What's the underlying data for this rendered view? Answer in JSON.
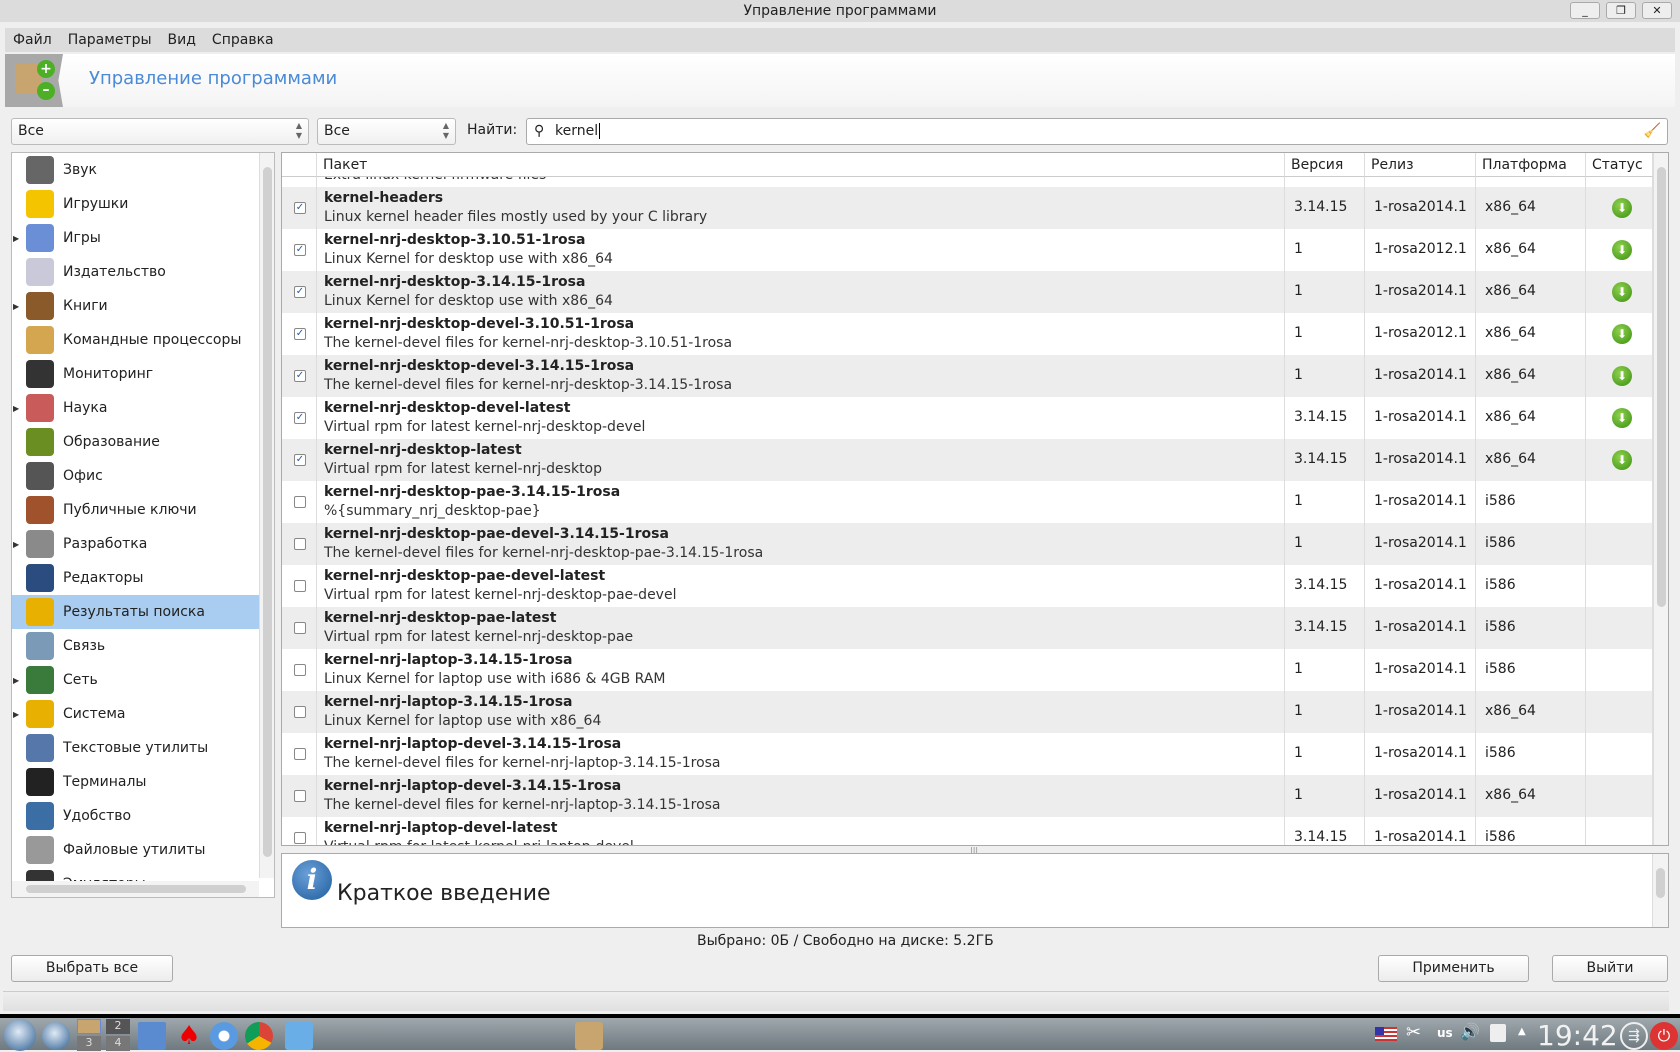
{
  "window": {
    "title": "Управление программами"
  },
  "menu": [
    "Файл",
    "Параметры",
    "Вид",
    "Справка"
  ],
  "banner": {
    "title": "Управление программами"
  },
  "filters": {
    "group": "Все",
    "state": "Все",
    "search_label": "Найти:",
    "search_value": "kernel"
  },
  "sidebar": [
    {
      "label": "Звук",
      "expand": false,
      "color": "#666"
    },
    {
      "label": "Игрушки",
      "expand": false,
      "color": "#f5c400"
    },
    {
      "label": "Игры",
      "expand": true,
      "color": "#6b8fd6"
    },
    {
      "label": "Издательство",
      "expand": false,
      "color": "#c9c9d9"
    },
    {
      "label": "Книги",
      "expand": true,
      "color": "#8b5a2b"
    },
    {
      "label": "Командные процессоры",
      "expand": false,
      "color": "#d4a650"
    },
    {
      "label": "Мониторинг",
      "expand": false,
      "color": "#333"
    },
    {
      "label": "Наука",
      "expand": true,
      "color": "#c95b5b"
    },
    {
      "label": "Образование",
      "expand": false,
      "color": "#6b8e23"
    },
    {
      "label": "Офис",
      "expand": false,
      "color": "#555"
    },
    {
      "label": "Публичные ключи",
      "expand": false,
      "color": "#a0522d"
    },
    {
      "label": "Разработка",
      "expand": true,
      "color": "#8a8a8a"
    },
    {
      "label": "Редакторы",
      "expand": false,
      "color": "#2b4c7e"
    },
    {
      "label": "Результаты поиска",
      "expand": false,
      "color": "#e8b000",
      "selected": true
    },
    {
      "label": "Связь",
      "expand": false,
      "color": "#7a9ab8"
    },
    {
      "label": "Сеть",
      "expand": true,
      "color": "#3a7a3a"
    },
    {
      "label": "Система",
      "expand": true,
      "color": "#e8b000"
    },
    {
      "label": "Текстовые утилиты",
      "expand": false,
      "color": "#5577aa"
    },
    {
      "label": "Терминалы",
      "expand": false,
      "color": "#222"
    },
    {
      "label": "Удобство",
      "expand": false,
      "color": "#3a6ea5"
    },
    {
      "label": "Файловые утилиты",
      "expand": false,
      "color": "#999"
    },
    {
      "label": "Эмуляторы",
      "expand": false,
      "color": "#333"
    }
  ],
  "table": {
    "columns": [
      "Пакет",
      "Версия",
      "Релиз",
      "Платформа",
      "Статус"
    ],
    "partial_top": "Extra linux kernel firmware files",
    "rows": [
      {
        "name": "kernel-headers",
        "desc": "Linux kernel header files mostly used by your C library",
        "version": "3.14.15",
        "release": "1-rosa2014.1",
        "platform": "x86_64",
        "checked": true,
        "installed": true
      },
      {
        "name": "kernel-nrj-desktop-3.10.51-1rosa",
        "desc": "Linux Kernel for desktop use with x86_64",
        "version": "1",
        "release": "1-rosa2012.1",
        "platform": "x86_64",
        "checked": true,
        "installed": true
      },
      {
        "name": "kernel-nrj-desktop-3.14.15-1rosa",
        "desc": "Linux Kernel for desktop use with x86_64",
        "version": "1",
        "release": "1-rosa2014.1",
        "platform": "x86_64",
        "checked": true,
        "installed": true
      },
      {
        "name": "kernel-nrj-desktop-devel-3.10.51-1rosa",
        "desc": "The kernel-devel files for kernel-nrj-desktop-3.10.51-1rosa",
        "version": "1",
        "release": "1-rosa2012.1",
        "platform": "x86_64",
        "checked": true,
        "installed": true
      },
      {
        "name": "kernel-nrj-desktop-devel-3.14.15-1rosa",
        "desc": "The kernel-devel files for kernel-nrj-desktop-3.14.15-1rosa",
        "version": "1",
        "release": "1-rosa2014.1",
        "platform": "x86_64",
        "checked": true,
        "installed": true
      },
      {
        "name": "kernel-nrj-desktop-devel-latest",
        "desc": "Virtual rpm for latest kernel-nrj-desktop-devel",
        "version": "3.14.15",
        "release": "1-rosa2014.1",
        "platform": "x86_64",
        "checked": true,
        "installed": true
      },
      {
        "name": "kernel-nrj-desktop-latest",
        "desc": "Virtual rpm for latest kernel-nrj-desktop",
        "version": "3.14.15",
        "release": "1-rosa2014.1",
        "platform": "x86_64",
        "checked": true,
        "installed": true
      },
      {
        "name": "kernel-nrj-desktop-pae-3.14.15-1rosa",
        "desc": "%{summary_nrj_desktop-pae}",
        "version": "1",
        "release": "1-rosa2014.1",
        "platform": "i586",
        "checked": false,
        "installed": false
      },
      {
        "name": "kernel-nrj-desktop-pae-devel-3.14.15-1rosa",
        "desc": "The kernel-devel files for kernel-nrj-desktop-pae-3.14.15-1rosa",
        "version": "1",
        "release": "1-rosa2014.1",
        "platform": "i586",
        "checked": false,
        "installed": false
      },
      {
        "name": "kernel-nrj-desktop-pae-devel-latest",
        "desc": "Virtual rpm for latest kernel-nrj-desktop-pae-devel",
        "version": "3.14.15",
        "release": "1-rosa2014.1",
        "platform": "i586",
        "checked": false,
        "installed": false
      },
      {
        "name": "kernel-nrj-desktop-pae-latest",
        "desc": "Virtual rpm for latest kernel-nrj-desktop-pae",
        "version": "3.14.15",
        "release": "1-rosa2014.1",
        "platform": "i586",
        "checked": false,
        "installed": false
      },
      {
        "name": "kernel-nrj-laptop-3.14.15-1rosa",
        "desc": "Linux Kernel for laptop use with i686 & 4GB RAM",
        "version": "1",
        "release": "1-rosa2014.1",
        "platform": "i586",
        "checked": false,
        "installed": false
      },
      {
        "name": "kernel-nrj-laptop-3.14.15-1rosa",
        "desc": "Linux Kernel for laptop use with x86_64",
        "version": "1",
        "release": "1-rosa2014.1",
        "platform": "x86_64",
        "checked": false,
        "installed": false
      },
      {
        "name": "kernel-nrj-laptop-devel-3.14.15-1rosa",
        "desc": "The kernel-devel files for kernel-nrj-laptop-3.14.15-1rosa",
        "version": "1",
        "release": "1-rosa2014.1",
        "platform": "i586",
        "checked": false,
        "installed": false
      },
      {
        "name": "kernel-nrj-laptop-devel-3.14.15-1rosa",
        "desc": "The kernel-devel files for kernel-nrj-laptop-3.14.15-1rosa",
        "version": "1",
        "release": "1-rosa2014.1",
        "platform": "x86_64",
        "checked": false,
        "installed": false
      },
      {
        "name": "kernel-nrj-laptop-devel-latest",
        "desc": "Virtual rpm for latest kernel-nrj-laptop-devel",
        "version": "3.14.15",
        "release": "1-rosa2014.1",
        "platform": "i586",
        "checked": false,
        "installed": false
      }
    ]
  },
  "info": {
    "title": "Краткое введение"
  },
  "status_text": "Выбрано: 0Б / Свободно на диске: 5.2ГБ",
  "buttons": {
    "select_all": "Выбрать все",
    "apply": "Применить",
    "quit": "Выйти"
  },
  "taskbar": {
    "desktops": [
      "2",
      "3",
      "4"
    ],
    "layout": "us",
    "clock": "19:42"
  },
  "colors": {
    "accent": "#4a8ad6",
    "selection": "#a8cdf0",
    "installed": "#3b8f10"
  }
}
